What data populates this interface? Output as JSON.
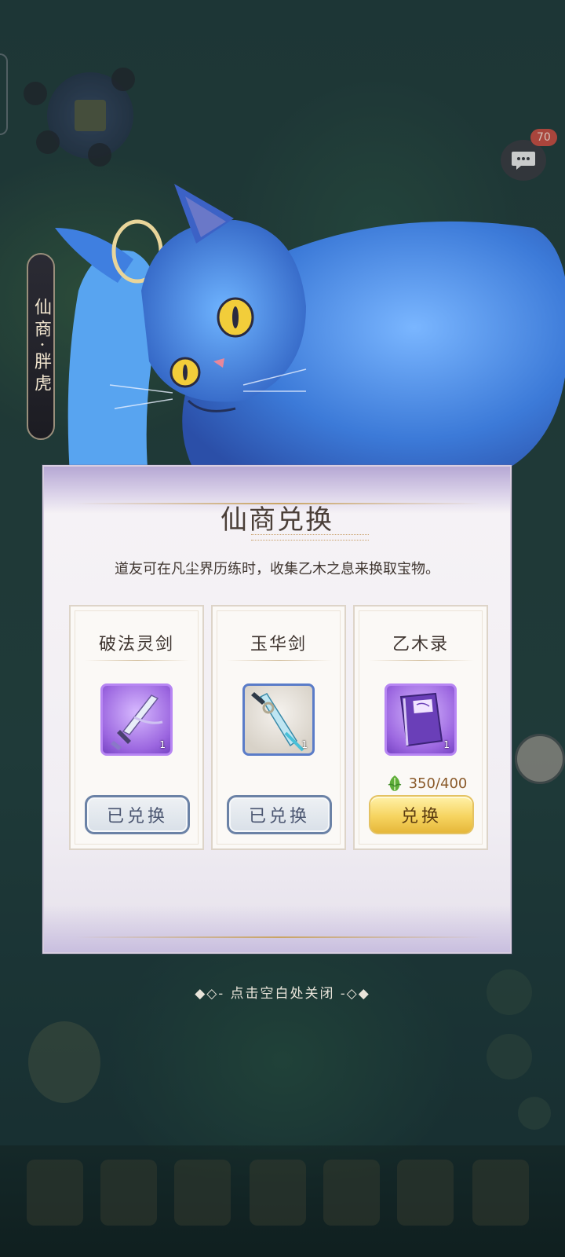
{
  "chat": {
    "badge": "70"
  },
  "merchant": {
    "name": "仙商·胖虎"
  },
  "dialog": {
    "title": "仙商兑换",
    "description": "道友可在凡尘界历练时，收集乙木之息来换取宝物。",
    "items": [
      {
        "name": "破法灵剑",
        "quantity": "1",
        "button": "已兑换",
        "state": "redeemed",
        "icon": "sword-icon"
      },
      {
        "name": "玉华剑",
        "quantity": "1",
        "button": "已兑换",
        "state": "redeemed",
        "icon": "sword-icon"
      },
      {
        "name": "乙木录",
        "quantity": "1",
        "cost": "350/400",
        "cost_icon": "leaf-icon",
        "button": "兑换",
        "state": "available",
        "icon": "book-icon"
      }
    ]
  },
  "close_hint": "点击空白处关闭"
}
